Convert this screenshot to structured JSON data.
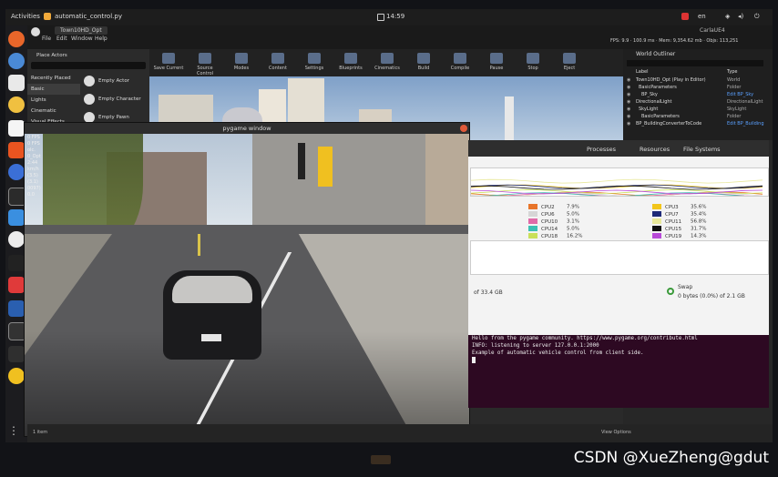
{
  "topbar": {
    "activities": "Activities",
    "app_name": "automatic_control.py",
    "clock": "14:59",
    "lang": "en"
  },
  "ue": {
    "title": "CarlaUE4",
    "level_tab": "Town10HD_Opt",
    "menu": [
      "File",
      "Edit",
      "Window",
      "Help"
    ],
    "place_actors": "Place Actors",
    "stats": "FPS: 9.9 · 100.9 ms · Mem: 9,354.62 mb · Objs: 113,251",
    "toolbar": [
      {
        "label": "Save Current"
      },
      {
        "label": "Source Control"
      },
      {
        "label": "Modes"
      },
      {
        "label": "Content"
      },
      {
        "label": "Settings"
      },
      {
        "label": "Blueprints"
      },
      {
        "label": "Cinematics"
      },
      {
        "label": "Build"
      },
      {
        "label": "Compile"
      },
      {
        "label": "Pause"
      },
      {
        "label": "Stop"
      },
      {
        "label": "Eject"
      }
    ],
    "place_categories": [
      "Recently Placed",
      "Basic",
      "Lights",
      "Cinematic",
      "Visual Effects"
    ],
    "place_items": [
      "Empty Actor",
      "Empty Character",
      "Empty Pawn"
    ],
    "outliner": {
      "title": "World Outliner",
      "col_label": "Label",
      "col_type": "Type",
      "rows": [
        {
          "label": "Town10HD_Opt (Play in Editor)",
          "type": "World"
        },
        {
          "label": "BasicParameters",
          "type": "Folder"
        },
        {
          "label": "BP_Sky",
          "type": "Edit BP_Sky"
        },
        {
          "label": "DirectionalLight",
          "type": "DirectionalLight"
        },
        {
          "label": "SkyLight",
          "type": "SkyLight"
        },
        {
          "label": "BasicParameters",
          "type": "Folder"
        },
        {
          "label": "BP_BuildingConverterToCode",
          "type": "Edit BP_Building"
        }
      ]
    },
    "status_left": "1 item",
    "view_options": "View Options"
  },
  "hud": {
    "lines": [
      "0 FPS",
      "0 FPS",
      "olc.",
      "0_Opt",
      "2:44",
      "km/h",
      "(3.5)",
      "(3.1)",
      "0097)",
      "0.0"
    ]
  },
  "pygame": {
    "title": "pygame window"
  },
  "sysmon": {
    "tabs": [
      "Processes",
      "Resources",
      "File Systems"
    ],
    "cpu": [
      {
        "name": "CPU2",
        "pct": "7.9%",
        "color": "#e8752a"
      },
      {
        "name": "CPU6",
        "pct": "5.0%",
        "color": "#d6d6d6"
      },
      {
        "name": "CPU10",
        "pct": "3.1%",
        "color": "#e06aa8"
      },
      {
        "name": "CPU14",
        "pct": "5.0%",
        "color": "#3bbfb3"
      },
      {
        "name": "CPU18",
        "pct": "16.2%",
        "color": "#c9e05a"
      },
      {
        "name": "CPU3",
        "pct": "35.6%",
        "color": "#f2c51b"
      },
      {
        "name": "CPU7",
        "pct": "35.4%",
        "color": "#1e2a78"
      },
      {
        "name": "CPU11",
        "pct": "56.8%",
        "color": "#e8e89a"
      },
      {
        "name": "CPU15",
        "pct": "31.7%",
        "color": "#111111"
      },
      {
        "name": "CPU19",
        "pct": "14.3%",
        "color": "#b84ad8"
      }
    ],
    "mem_text": "of 33.4 GB",
    "swap_label": "Swap",
    "swap_text": "0 bytes (0.0%) of 2.1 GB"
  },
  "terminal": {
    "lines": [
      "Hello from the pygame community. https://www.pygame.org/contribute.html",
      "INFO: listening to server 127.0.0.1:2000",
      "Example of automatic vehicle control from client side."
    ]
  },
  "watermark": "CSDN @XueZheng@gdut"
}
